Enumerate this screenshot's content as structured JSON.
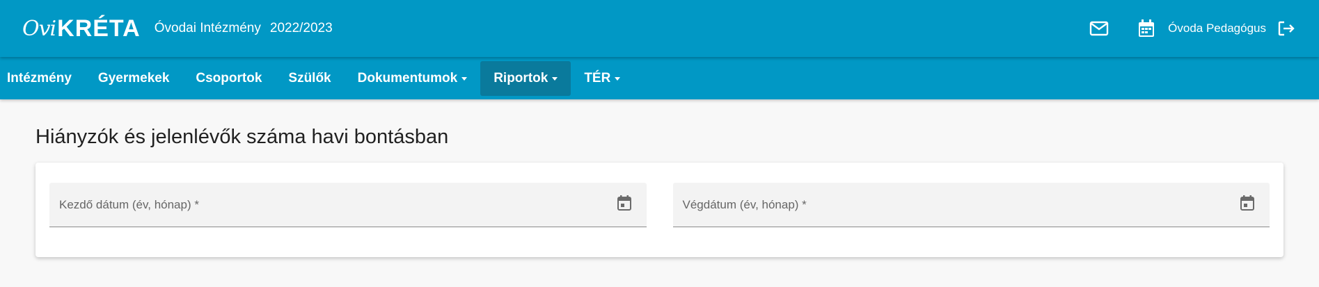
{
  "header": {
    "logo_ovi": "Ovi",
    "logo_kreta": "KRÉTA",
    "institution": "Óvodai Intézmény",
    "school_year": "2022/2023",
    "user_name": "Óvoda Pedagógus",
    "icons": [
      "mail-icon",
      "calendar-icon",
      "logout-icon"
    ]
  },
  "nav": {
    "items": [
      {
        "label": "Intézmény",
        "dropdown": false
      },
      {
        "label": "Gyermekek",
        "dropdown": false
      },
      {
        "label": "Csoportok",
        "dropdown": false
      },
      {
        "label": "Szülők",
        "dropdown": false
      },
      {
        "label": "Dokumentumok",
        "dropdown": true
      },
      {
        "label": "Riportok",
        "dropdown": true,
        "active": true
      },
      {
        "label": "TÉR",
        "dropdown": true
      }
    ]
  },
  "main": {
    "title": "Hiányzók és jelenlévők száma havi bontásban",
    "start_date_label": "Kezdő dátum (év, hónap) *",
    "end_date_label": "Végdátum (év, hónap) *"
  },
  "colors": {
    "primary": "#0198c5",
    "nav_active": "#0a7a9c",
    "background": "#f8f8f8"
  }
}
